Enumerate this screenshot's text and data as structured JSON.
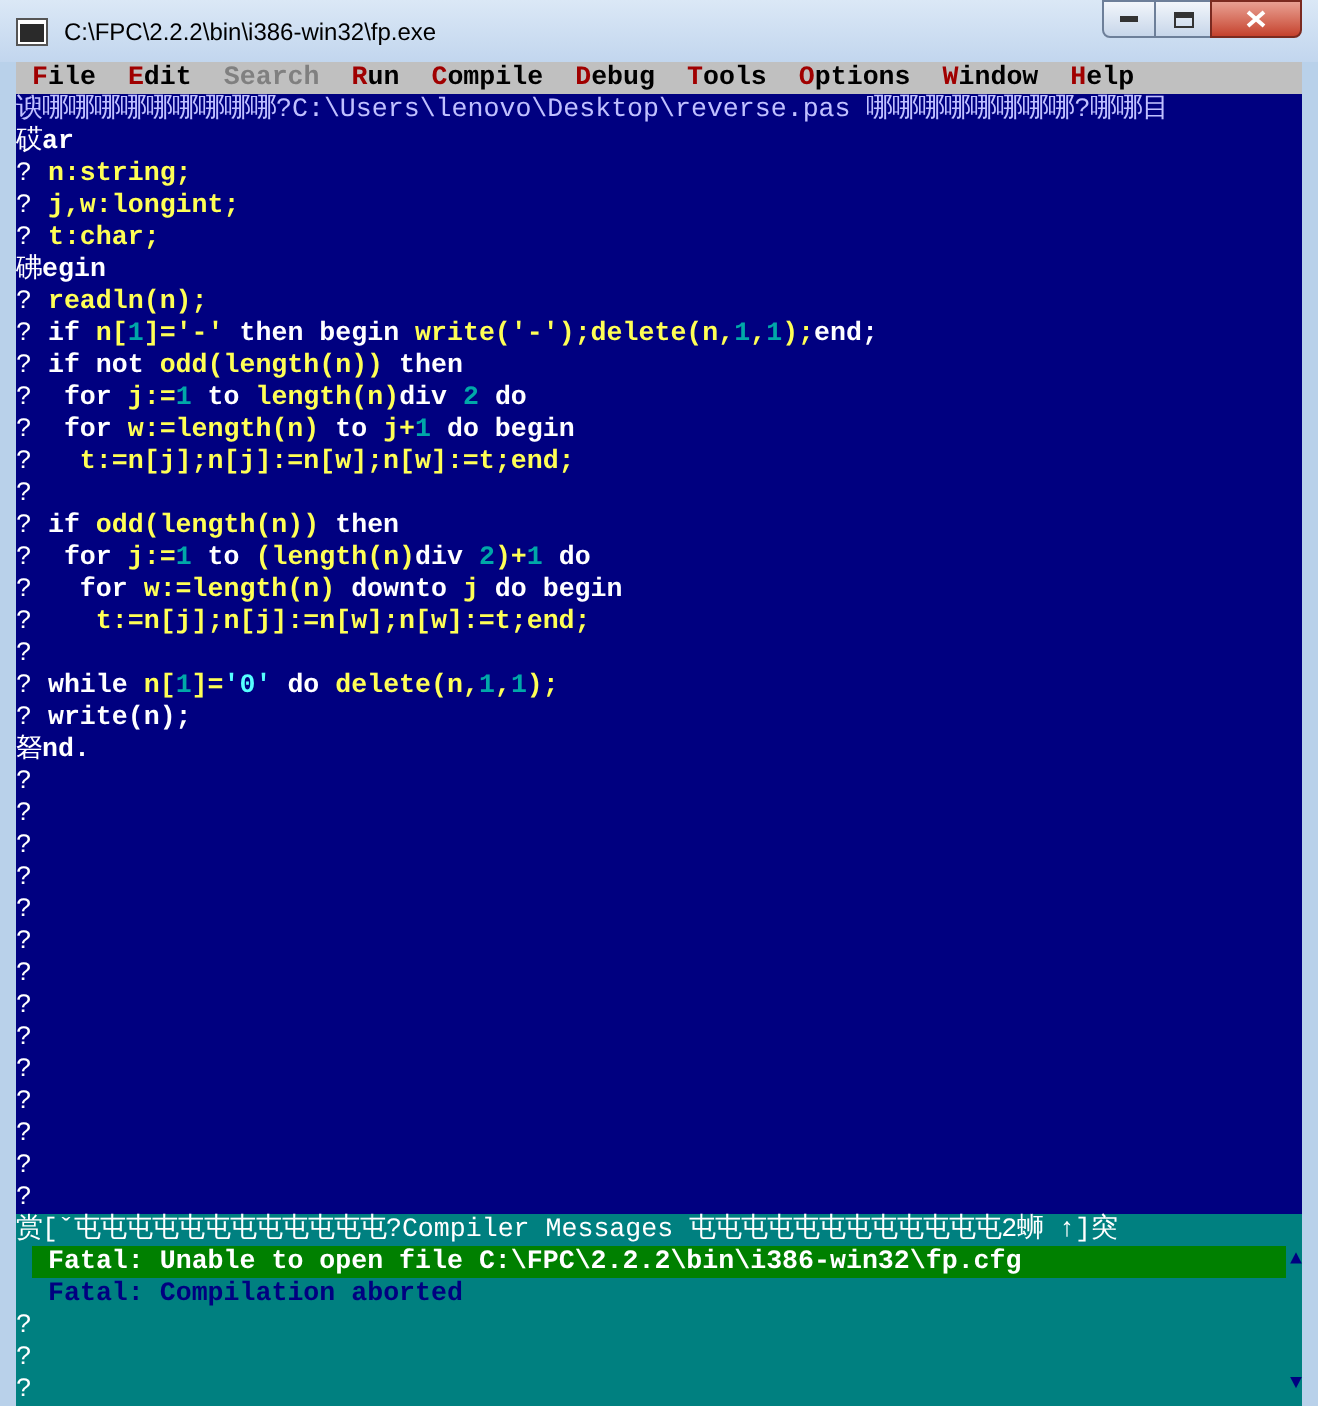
{
  "window": {
    "title": "C:\\FPC\\2.2.2\\bin\\i386-win32\\fp.exe"
  },
  "menu": [
    {
      "label": "File",
      "disabled": false
    },
    {
      "label": "Edit",
      "disabled": false
    },
    {
      "label": "Search",
      "disabled": true
    },
    {
      "label": "Run",
      "disabled": false
    },
    {
      "label": "Compile",
      "disabled": false
    },
    {
      "label": "Debug",
      "disabled": false
    },
    {
      "label": "Tools",
      "disabled": false
    },
    {
      "label": "Options",
      "disabled": false
    },
    {
      "label": "Window",
      "disabled": false
    },
    {
      "label": "Help",
      "disabled": false
    }
  ],
  "editor": {
    "title": "谀哪哪哪哪哪哪哪哪哪?C:\\Users\\lenovo\\Desktop\\reverse.pas 哪哪哪哪哪哪哪哪?哪哪目",
    "lines": [
      {
        "gutter": "砹",
        "segments": [
          {
            "kind": "keyword",
            "text": "ar"
          }
        ]
      },
      {
        "gutter": "?",
        "segments": [
          {
            "kind": "ident",
            "text": " n:string;"
          }
        ]
      },
      {
        "gutter": "?",
        "segments": [
          {
            "kind": "ident",
            "text": " j,w:longint;"
          }
        ]
      },
      {
        "gutter": "?",
        "segments": [
          {
            "kind": "ident",
            "text": " t:char;"
          }
        ]
      },
      {
        "gutter": "砩",
        "segments": [
          {
            "kind": "keyword",
            "text": "egin"
          }
        ]
      },
      {
        "gutter": "?",
        "segments": [
          {
            "kind": "ident",
            "text": " readln(n);"
          }
        ]
      },
      {
        "gutter": "?",
        "segments": [
          {
            "kind": "keyword",
            "text": " if "
          },
          {
            "kind": "ident",
            "text": "n["
          },
          {
            "kind": "number",
            "text": "1"
          },
          {
            "kind": "ident",
            "text": "]='-' "
          },
          {
            "kind": "keyword",
            "text": "then begin "
          },
          {
            "kind": "ident",
            "text": "write('-');delete(n,"
          },
          {
            "kind": "number",
            "text": "1"
          },
          {
            "kind": "ident",
            "text": ","
          },
          {
            "kind": "number",
            "text": "1"
          },
          {
            "kind": "ident",
            "text": ");"
          },
          {
            "kind": "keyword",
            "text": "end;"
          }
        ]
      },
      {
        "gutter": "?",
        "segments": [
          {
            "kind": "keyword",
            "text": " if not "
          },
          {
            "kind": "ident",
            "text": "odd(length(n)) "
          },
          {
            "kind": "keyword",
            "text": "then"
          }
        ]
      },
      {
        "gutter": "?",
        "segments": [
          {
            "kind": "keyword",
            "text": "  for "
          },
          {
            "kind": "ident",
            "text": "j:="
          },
          {
            "kind": "number",
            "text": "1"
          },
          {
            "kind": "keyword",
            "text": " to "
          },
          {
            "kind": "ident",
            "text": "length(n)"
          },
          {
            "kind": "keyword",
            "text": "div "
          },
          {
            "kind": "number",
            "text": "2"
          },
          {
            "kind": "keyword",
            "text": " do"
          }
        ]
      },
      {
        "gutter": "?",
        "segments": [
          {
            "kind": "keyword",
            "text": "  for "
          },
          {
            "kind": "ident",
            "text": "w:=length(n)"
          },
          {
            "kind": "keyword",
            "text": " to "
          },
          {
            "kind": "ident",
            "text": "j+"
          },
          {
            "kind": "number",
            "text": "1"
          },
          {
            "kind": "keyword",
            "text": " do begin"
          }
        ]
      },
      {
        "gutter": "?",
        "segments": [
          {
            "kind": "ident",
            "text": "   t:=n[j];n[j]:=n[w];n[w]:=t;end;"
          }
        ]
      },
      {
        "gutter": "?"
      },
      {
        "gutter": "?",
        "segments": [
          {
            "kind": "keyword",
            "text": " if "
          },
          {
            "kind": "ident",
            "text": "odd(length(n)) "
          },
          {
            "kind": "keyword",
            "text": "then"
          }
        ]
      },
      {
        "gutter": "?",
        "segments": [
          {
            "kind": "keyword",
            "text": "  for "
          },
          {
            "kind": "ident",
            "text": "j:="
          },
          {
            "kind": "number",
            "text": "1"
          },
          {
            "kind": "keyword",
            "text": " to "
          },
          {
            "kind": "ident",
            "text": "(length(n)"
          },
          {
            "kind": "keyword",
            "text": "div "
          },
          {
            "kind": "number",
            "text": "2"
          },
          {
            "kind": "ident",
            "text": ")+"
          },
          {
            "kind": "number",
            "text": "1"
          },
          {
            "kind": "keyword",
            "text": " do"
          }
        ]
      },
      {
        "gutter": "?",
        "segments": [
          {
            "kind": "keyword",
            "text": "   for "
          },
          {
            "kind": "ident",
            "text": "w:=length(n) "
          },
          {
            "kind": "keyword",
            "text": "downto "
          },
          {
            "kind": "ident",
            "text": "j "
          },
          {
            "kind": "keyword",
            "text": "do begin"
          }
        ]
      },
      {
        "gutter": "?",
        "segments": [
          {
            "kind": "ident",
            "text": "    t:=n[j];n[j]:=n[w];n[w]:=t;end;"
          }
        ]
      },
      {
        "gutter": "?"
      },
      {
        "gutter": "?",
        "segments": [
          {
            "kind": "keyword",
            "text": " while "
          },
          {
            "kind": "ident",
            "text": "n["
          },
          {
            "kind": "number",
            "text": "1"
          },
          {
            "kind": "ident",
            "text": "]="
          },
          {
            "kind": "string",
            "text": "'0'"
          },
          {
            "kind": "keyword",
            "text": " do "
          },
          {
            "kind": "ident",
            "text": "delete(n,"
          },
          {
            "kind": "number",
            "text": "1"
          },
          {
            "kind": "ident",
            "text": ","
          },
          {
            "kind": "number",
            "text": "1"
          },
          {
            "kind": "ident",
            "text": ");"
          }
        ]
      },
      {
        "gutter": "?",
        "segments": [
          {
            "kind": "keyword",
            "text": " write(n);"
          }
        ]
      },
      {
        "gutter": "砮",
        "segments": [
          {
            "kind": "keyword",
            "text": "nd."
          }
        ]
      },
      {
        "gutter": "?"
      },
      {
        "gutter": "?"
      },
      {
        "gutter": "?"
      },
      {
        "gutter": "?"
      },
      {
        "gutter": "?"
      },
      {
        "gutter": "?"
      },
      {
        "gutter": "?"
      },
      {
        "gutter": "?"
      },
      {
        "gutter": "?"
      },
      {
        "gutter": "?"
      },
      {
        "gutter": "?"
      },
      {
        "gutter": "?"
      },
      {
        "gutter": "?"
      },
      {
        "gutter": "?"
      }
    ]
  },
  "messages": {
    "title": "赏[ˇ屯屯屯屯屯屯屯屯屯屯屯屯?Compiler Messages 屯屯屯屯屯屯屯屯屯屯屯屯2蛳 ↑]突",
    "items": [
      {
        "text": "Fatal: Unable to open file C:\\FPC\\2.2.2\\bin\\i386-win32\\fp.cfg",
        "selected": true
      },
      {
        "text": "Fatal: Compilation aborted",
        "selected": false
      }
    ],
    "gutter": [
      "?",
      "?",
      "?"
    ],
    "scroll_up": "▲",
    "scroll_down": "▼"
  }
}
